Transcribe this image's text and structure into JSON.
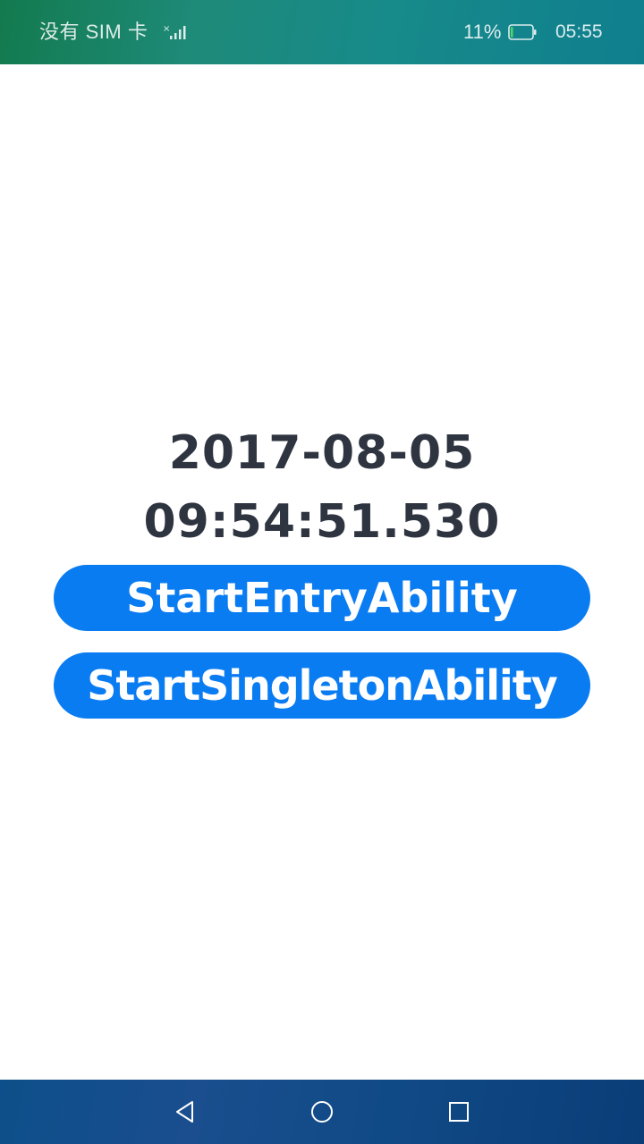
{
  "status_bar": {
    "carrier": "没有 SIM 卡",
    "battery_percent": "11%",
    "battery_level": 0.11,
    "time": "05:55",
    "icons": [
      "signal-icon",
      "battery-icon"
    ]
  },
  "main": {
    "date": "2017-08-05",
    "time": "09:54:51.530",
    "buttons": [
      {
        "label": "StartEntryAbility"
      },
      {
        "label": "StartSingletonAbility"
      }
    ]
  },
  "nav_bar": {
    "icons": [
      "back-icon",
      "home-icon",
      "recent-apps-icon"
    ]
  },
  "colors": {
    "button_bg": "#0a7cf2",
    "text_dark": "#2e3440",
    "status_bar": "#178a78",
    "nav_bar": "#104a86"
  }
}
